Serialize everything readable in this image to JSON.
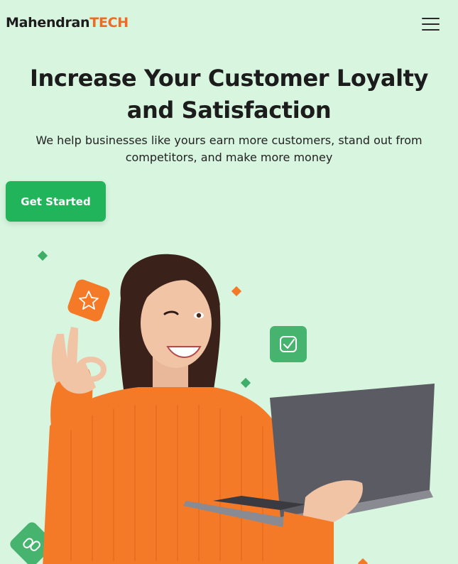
{
  "brand": {
    "name_part1": "Mahendran",
    "name_part2": "TECH",
    "colors": {
      "dark": "#1c1c1c",
      "accent": "#f06a22"
    }
  },
  "nav": {
    "menu_icon": "hamburger-menu-icon"
  },
  "hero": {
    "title_line1": "Increase Your Customer Loyalty",
    "title_line2": "and Satisfaction",
    "subtitle": "We help businesses like yours earn more customers, stand out from competitors, and make more money",
    "cta_label": "Get Started",
    "cta_color": "#22b45a"
  },
  "illustration": {
    "subject": "smiling woman in orange sweater holding a laptop and making ok hand sign",
    "icons": [
      "star-badge-icon",
      "check-badge-icon",
      "link-badge-icon"
    ],
    "colors": {
      "background": "#d8f5df",
      "orange": "#f47a28",
      "green": "#3fae69"
    }
  }
}
